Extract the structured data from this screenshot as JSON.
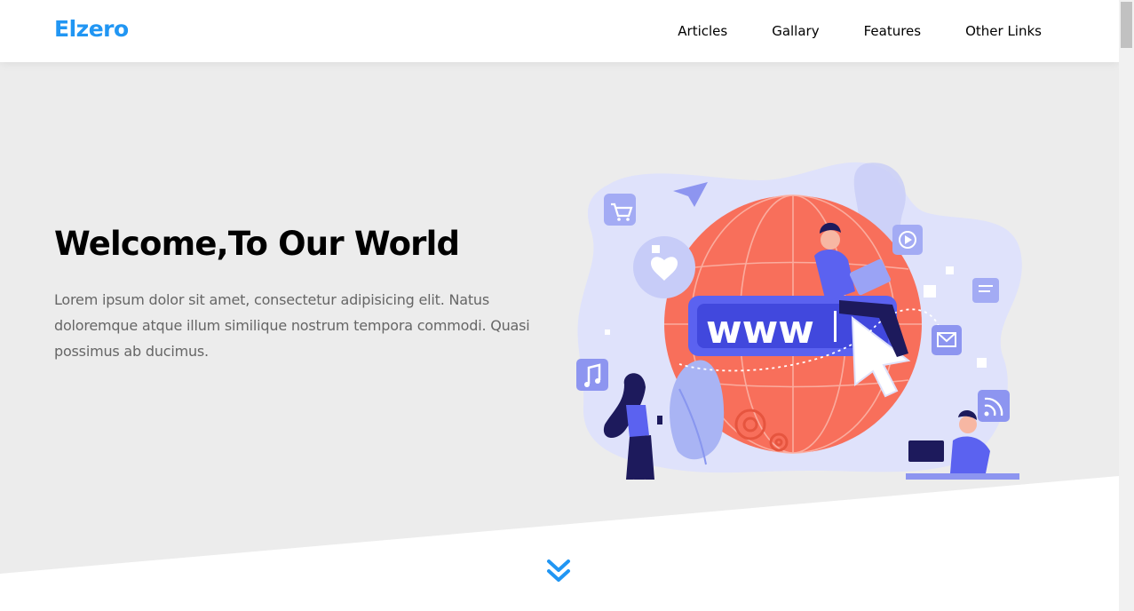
{
  "header": {
    "logo": "Elzero",
    "nav": [
      "Articles",
      "Gallary",
      "Features",
      "Other Links"
    ]
  },
  "landing": {
    "title": "Welcome,To Our World",
    "description": "Lorem ipsum dolor sit amet, consectetur adipisicing elit. Natus doloremque atque illum similique nostrum tempora commodi. Quasi possimus ab ducimus.",
    "illustration_text": "www"
  },
  "colors": {
    "accent": "#2196f3",
    "landing_bg": "#ececec",
    "globe": "#f86f5b",
    "illustration_primary": "#5b62f0"
  },
  "icons": {
    "go_down": "double-chevron-down-icon"
  }
}
